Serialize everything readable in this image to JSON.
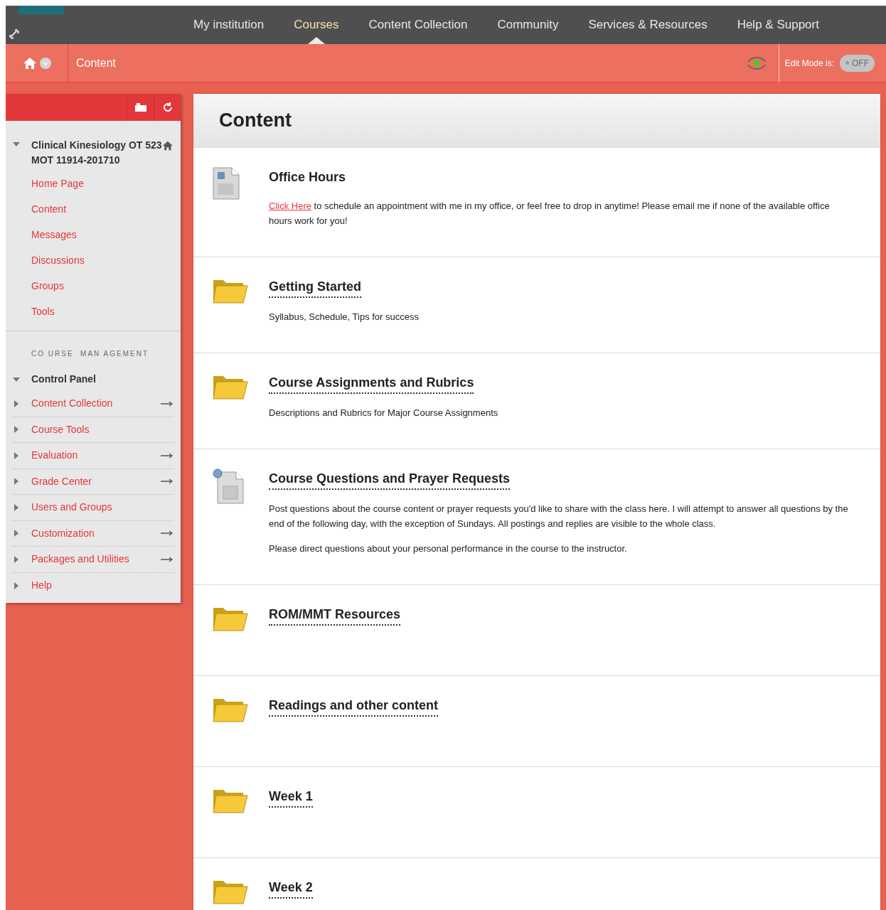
{
  "nav": {
    "tabs": [
      {
        "label": "My institution",
        "selected": false
      },
      {
        "label": "Courses",
        "selected": true
      },
      {
        "label": "Content Collection",
        "selected": false
      },
      {
        "label": "Community",
        "selected": false
      },
      {
        "label": "Services & Resources",
        "selected": false
      },
      {
        "label": "Help & Support",
        "selected": false
      }
    ]
  },
  "breadcrumb": {
    "current": "Content",
    "edit_mode_label": "Edit Mode is:",
    "edit_mode": {
      "on": false,
      "label": "OFF"
    }
  },
  "course_menu": {
    "course_title": "Clinical Kinesiology OT 523 MOT 11914-201710",
    "expanded": true,
    "links": [
      "Home Page",
      "Content",
      "Messages",
      "Discussions",
      "Groups",
      "Tools"
    ],
    "management_heading": "CO URSE  MAN AGEMENT",
    "control_panel": {
      "label": "Control Panel",
      "expanded": true,
      "items": [
        {
          "label": "Content Collection",
          "flyout": true
        },
        {
          "label": "Course Tools",
          "flyout": false
        },
        {
          "label": "Evaluation",
          "flyout": true
        },
        {
          "label": "Grade Center",
          "flyout": true
        },
        {
          "label": "Users and Groups",
          "flyout": false
        },
        {
          "label": "Customization",
          "flyout": true
        },
        {
          "label": "Packages and Utilities",
          "flyout": true
        },
        {
          "label": "Help",
          "flyout": false
        }
      ]
    }
  },
  "page_title": "Content",
  "items": [
    {
      "kind": "document",
      "title": "Office Hours",
      "link": "Click Here",
      "paragraphs": [
        "to schedule an appointment with me in my office, or feel free to drop in anytime! Please email me if none of the available office hours work for you!"
      ]
    },
    {
      "kind": "folder",
      "title": "Getting Started",
      "paragraphs": [
        "Syllabus, Schedule, Tips for success"
      ]
    },
    {
      "kind": "folder",
      "title": "Course Assignments and Rubrics",
      "paragraphs": [
        "Descriptions and Rubrics for Major Course Assignments"
      ]
    },
    {
      "kind": "discussion",
      "title": "Course Questions and Prayer Requests",
      "paragraphs": [
        "Post questions about the course content or prayer requests you'd like to share with the class here.  I will attempt to answer all questions by the end of the following day, with the exception of Sundays.  All postings and replies are visible to the whole class.",
        "Please direct questions about your personal performance in the course to the instructor."
      ]
    },
    {
      "kind": "folder",
      "title": "ROM/MMT Resources"
    },
    {
      "kind": "folder",
      "title": "Readings and other content"
    },
    {
      "kind": "folder",
      "title": "Week 1"
    },
    {
      "kind": "folder",
      "title": "Week 2"
    }
  ]
}
